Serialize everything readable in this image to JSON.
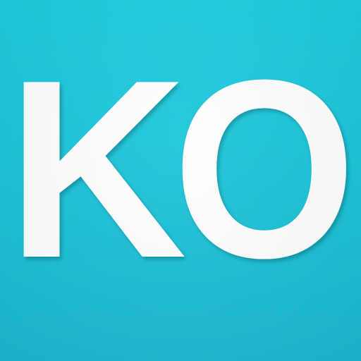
{
  "icon": {
    "label_letter_1": "K",
    "label_letter_2": "O",
    "background_color": "#1bc4da",
    "text_color": "#ffffff"
  }
}
